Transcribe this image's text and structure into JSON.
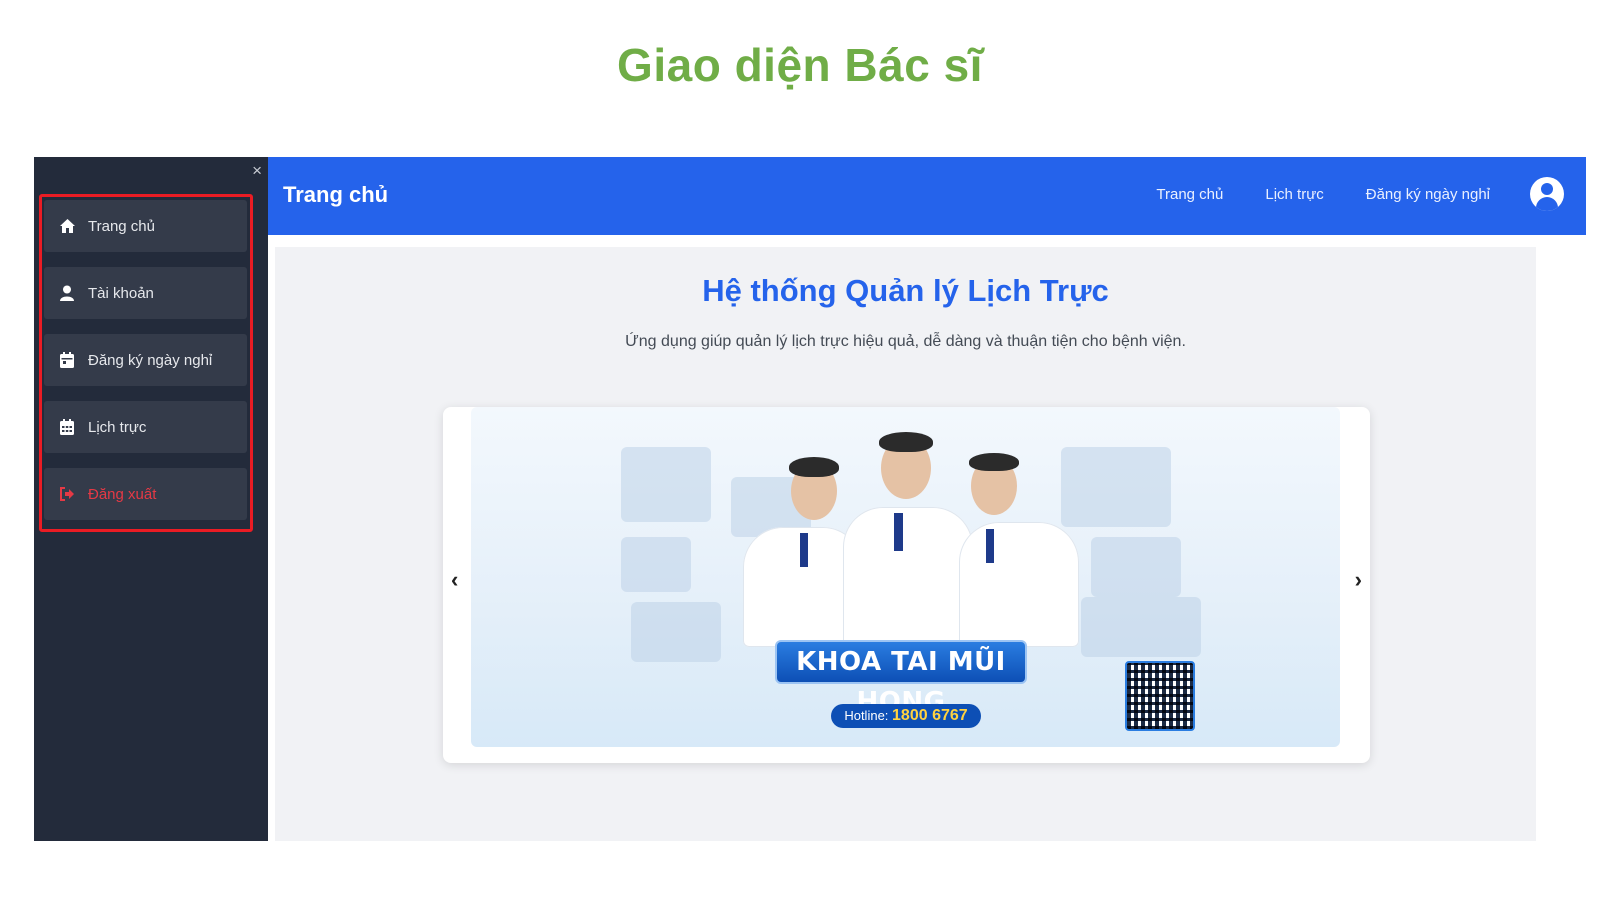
{
  "slide": {
    "title": "Giao diện Bác sĩ"
  },
  "sidebar": {
    "close_symbol": "×",
    "items": [
      {
        "label": "Trang chủ",
        "icon": "home-icon"
      },
      {
        "label": "Tài khoản",
        "icon": "user-icon"
      },
      {
        "label": "Đăng ký ngày nghỉ",
        "icon": "calendar-icon"
      },
      {
        "label": "Lịch trực",
        "icon": "calendar-grid-icon"
      },
      {
        "label": "Đăng xuất",
        "icon": "logout-icon"
      }
    ]
  },
  "header": {
    "title": "Trang chủ",
    "nav": [
      "Trang chủ",
      "Lịch trực",
      "Đăng ký ngày nghỉ"
    ],
    "accent_color": "#2563eb"
  },
  "main": {
    "title": "Hệ thống Quản lý Lịch Trực",
    "subtitle": "Ứng dụng giúp quản lý lịch trực hiệu quả, dễ dàng và thuận tiện cho bệnh viện.",
    "carousel": {
      "prev_symbol": "‹",
      "next_symbol": "›",
      "banner_title": "KHOA TAI MŨI HỌNG",
      "hotline_label": "Hotline:",
      "hotline_number": "1800 6767"
    }
  }
}
